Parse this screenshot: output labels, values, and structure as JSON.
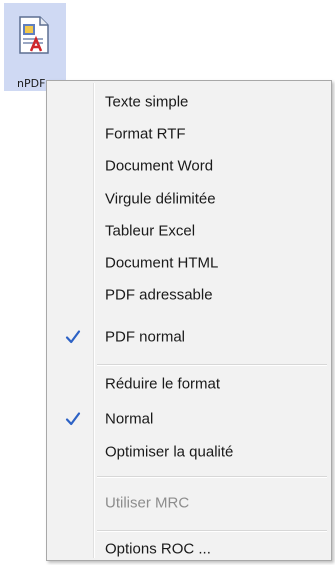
{
  "desktop_icon": {
    "label": "nPDF"
  },
  "menu": {
    "items": [
      {
        "label": "Texte simple",
        "checked": false
      },
      {
        "label": "Format RTF",
        "checked": false
      },
      {
        "label": "Document Word",
        "checked": false
      },
      {
        "label": "Virgule délimitée",
        "checked": false
      },
      {
        "label": "Tableur Excel",
        "checked": false
      },
      {
        "label": "Document HTML",
        "checked": false
      },
      {
        "label": "PDF adressable",
        "checked": false
      },
      {
        "label": "PDF normal",
        "checked": true
      },
      {
        "label": "Réduire le format",
        "checked": false
      },
      {
        "label": "Normal",
        "checked": true
      },
      {
        "label": "Optimiser la qualité",
        "checked": false
      },
      {
        "label": "Utiliser MRC",
        "checked": false,
        "disabled": true
      },
      {
        "label": "Options ROC ...",
        "checked": false
      }
    ]
  },
  "colors": {
    "check": "#2d62c5",
    "icon_highlight": "#cfd9f3"
  }
}
